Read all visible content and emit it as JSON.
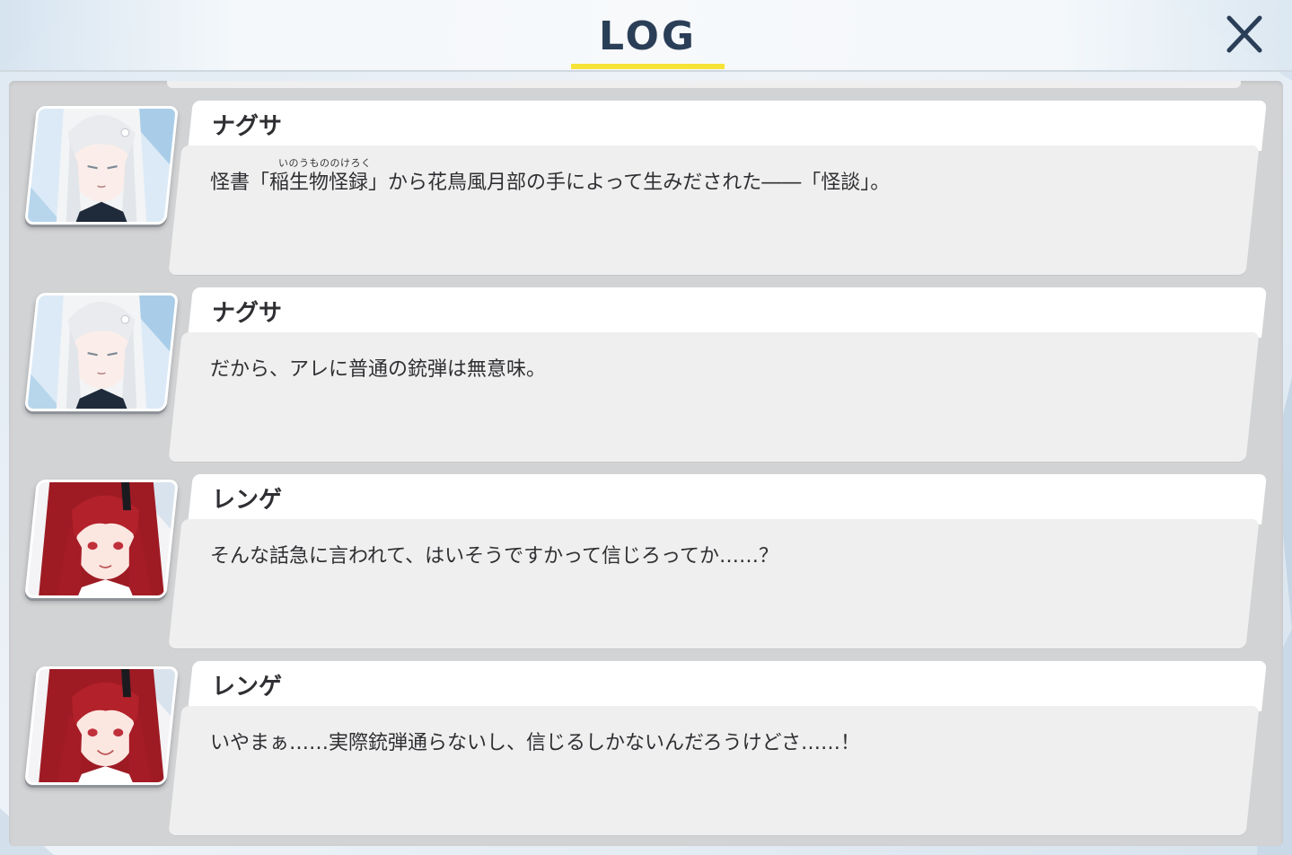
{
  "header": {
    "title": "LOG",
    "close_icon": "close-icon"
  },
  "accent": {
    "underline": "#f6e337",
    "title_color": "#2b3e57"
  },
  "entries": [
    {
      "speaker": "ナグサ",
      "avatar": "nagusa-avatar",
      "ruby": "いのうもののけろく",
      "text": "怪書「稲生物怪録」から花鳥風月部の手によって生みだされた――「怪談」。"
    },
    {
      "speaker": "ナグサ",
      "avatar": "nagusa-avatar",
      "text": "だから、アレに普通の銃弾は無意味。"
    },
    {
      "speaker": "レンゲ",
      "avatar": "renge-avatar",
      "text": "そんな話急に言われて、はいそうですかって信じろってか……？"
    },
    {
      "speaker": "レンゲ",
      "avatar": "renge-avatar",
      "text": "いやまぁ……実際銃弾通らないし、信じるしかないんだろうけどさ……！"
    }
  ]
}
